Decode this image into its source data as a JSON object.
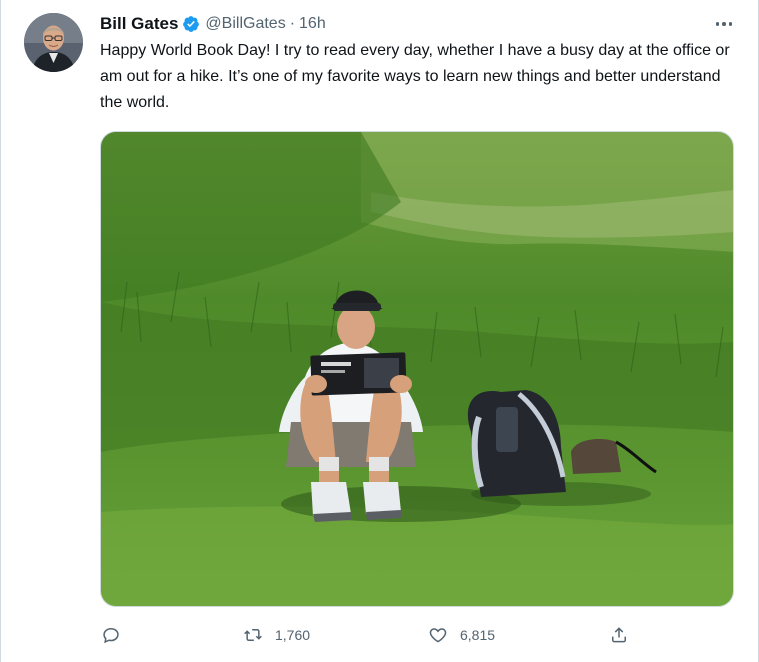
{
  "tweet": {
    "author_name": "Bill Gates",
    "handle": "@BillGates",
    "separator": "·",
    "time": "16h",
    "text": "Happy World Book Day! I try to read every day, whether I have a busy day at the office or am out for a hike. It’s one of my favorite ways to learn new things and better understand the world.",
    "verified": true
  },
  "actions": {
    "reply_count": "",
    "retweet_count": "1,760",
    "like_count": "6,815"
  },
  "colors": {
    "text_primary": "#0f1419",
    "text_secondary": "#536471",
    "verified_blue": "#1d9bf0",
    "border": "#cfd9de"
  },
  "icons": {
    "verified": "verified-badge-icon",
    "more": "more-options-icon",
    "reply": "reply-icon",
    "retweet": "retweet-icon",
    "like": "heart-icon",
    "share": "share-icon"
  }
}
